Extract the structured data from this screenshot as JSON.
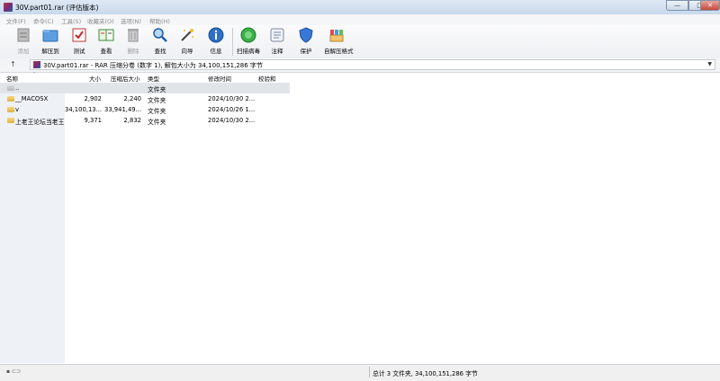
{
  "window": {
    "title": "30V.part01.rar (评估版本)",
    "min_label": "—",
    "max_label": "□",
    "close_label": "✕"
  },
  "menu": [
    "文件(F)",
    "命令(C)",
    "工具(S)",
    "收藏夹(O)",
    "选项(N)",
    "帮助(H)"
  ],
  "toolbar": [
    {
      "label": "添加",
      "icon": "archive-add-icon",
      "disabled": true
    },
    {
      "label": "解压到",
      "icon": "extract-folder-icon",
      "disabled": false
    },
    {
      "label": "测试",
      "icon": "test-icon",
      "disabled": false
    },
    {
      "label": "查看",
      "icon": "view-book-icon",
      "disabled": false
    },
    {
      "label": "删除",
      "icon": "trash-icon",
      "disabled": true
    },
    {
      "label": "查找",
      "icon": "find-magnifier-icon",
      "disabled": false
    },
    {
      "label": "向导",
      "icon": "wizard-wand-icon",
      "disabled": false
    },
    {
      "label": "信息",
      "icon": "info-icon",
      "disabled": false
    },
    {
      "label": "扫描病毒",
      "icon": "virus-scan-icon",
      "disabled": false
    },
    {
      "label": "注释",
      "icon": "comment-icon",
      "disabled": false
    },
    {
      "label": "保护",
      "icon": "shield-icon",
      "disabled": false
    },
    {
      "label": "自解压格式",
      "icon": "sfx-icon",
      "disabled": false
    }
  ],
  "address": {
    "up_label": "↑",
    "path": "30V.part01.rar - RAR 压缩分卷 (数字 1), 解包大小为 34,100,151,286 字节",
    "dropdown": "▼"
  },
  "columns": {
    "name": "名称",
    "size": "大小",
    "packed": "压缩后大小",
    "type": "类型",
    "modified": "修改时间",
    "crc": "校验和",
    "sort_indicator": "^"
  },
  "rows": [
    {
      "name": "..",
      "size": "",
      "packed": "",
      "type": "文件夹",
      "modified": "",
      "crc": "",
      "up": true,
      "selected": true
    },
    {
      "name": "__MACOSX",
      "size": "2,902",
      "packed": "2,240",
      "type": "文件夹",
      "modified": "2024/10/30 2...",
      "crc": "",
      "up": false,
      "selected": false
    },
    {
      "name": "v",
      "size": "34,100,13...",
      "packed": "33,941,49...",
      "type": "文件夹",
      "modified": "2024/10/26 1...",
      "crc": "",
      "up": false,
      "selected": false
    },
    {
      "name": "上老王论坛当老王",
      "size": "9,371",
      "packed": "2,832",
      "type": "文件夹",
      "modified": "2024/10/30 2...",
      "crc": "",
      "up": false,
      "selected": false
    }
  ],
  "status": {
    "icons": "▪ ⊂⊃",
    "text": "总计 3 文件夹, 34,100,151,286 字节"
  }
}
